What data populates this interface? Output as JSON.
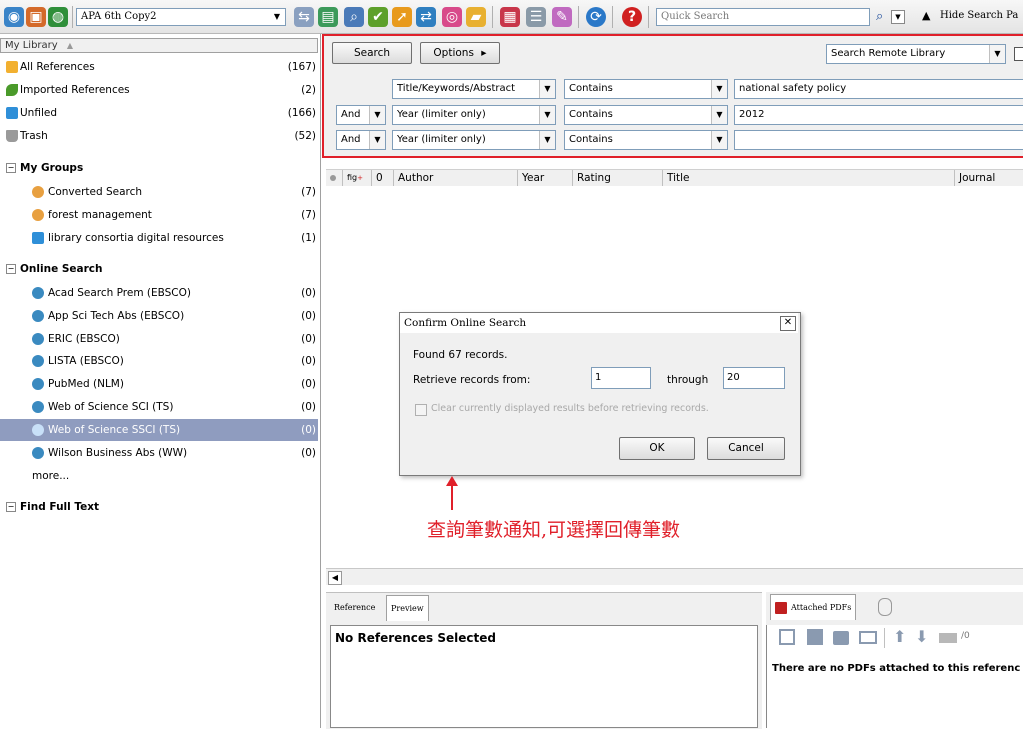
{
  "toolbar": {
    "style_name": "APA 6th Copy2",
    "quick_search_placeholder": "Quick Search",
    "hide_search_label": "Hide Search Pa"
  },
  "sidebar": {
    "header": "My Library",
    "library_items": [
      {
        "label": "All References",
        "count": "(167)",
        "icon": "all-references-icon"
      },
      {
        "label": "Imported References",
        "count": "(2)",
        "icon": "imported-references-icon"
      },
      {
        "label": "Unfiled",
        "count": "(166)",
        "icon": "unfiled-folder-icon"
      },
      {
        "label": "Trash",
        "count": "(52)",
        "icon": "trash-icon"
      }
    ],
    "my_groups_label": "My Groups",
    "groups": [
      {
        "label": "Converted Search",
        "count": "(7)"
      },
      {
        "label": "forest management",
        "count": "(7)"
      },
      {
        "label": "library consortia digital resources",
        "count": "(1)"
      }
    ],
    "online_search_label": "Online Search",
    "online_items": [
      {
        "label": "Acad Search Prem (EBSCO)",
        "count": "(0)"
      },
      {
        "label": "App Sci Tech Abs (EBSCO)",
        "count": "(0)"
      },
      {
        "label": "ERIC (EBSCO)",
        "count": "(0)"
      },
      {
        "label": "LISTA (EBSCO)",
        "count": "(0)"
      },
      {
        "label": "PubMed (NLM)",
        "count": "(0)"
      },
      {
        "label": "Web of Science SCI (TS)",
        "count": "(0)"
      },
      {
        "label": "Web of Science SSCI (TS)",
        "count": "(0)"
      },
      {
        "label": "Wilson Business Abs (WW)",
        "count": "(0)"
      }
    ],
    "more_label": "more...",
    "find_full_text_label": "Find Full Text"
  },
  "search": {
    "search_button": "Search",
    "options_button": "Options",
    "options_arrow": "▸",
    "remote_library": "Search Remote Library",
    "rows": [
      {
        "bool": "",
        "field": "Title/Keywords/Abstract",
        "op": "Contains",
        "value": "national safety policy"
      },
      {
        "bool": "And",
        "field": "Year (limiter only)",
        "op": "Contains",
        "value": "2012"
      },
      {
        "bool": "And",
        "field": "Year (limiter only)",
        "op": "Contains",
        "value": ""
      }
    ]
  },
  "columns": {
    "fig": "fig",
    "attach": "0",
    "author": "Author",
    "year": "Year",
    "rating": "Rating",
    "title": "Title",
    "journal": "Journal"
  },
  "dialog": {
    "title": "Confirm Online Search",
    "found": "Found 67 records.",
    "retrieve_label": "Retrieve records from:",
    "from_value": "1",
    "through_label": "through",
    "through_value": "20",
    "clear_label": "Clear currently displayed results before retrieving records.",
    "ok": "OK",
    "cancel": "Cancel"
  },
  "annotation": "查詢筆數通知,可選擇回傳筆數",
  "bottom": {
    "tab_reference": "Reference",
    "tab_preview": "Preview",
    "no_refs": "No References Selected",
    "tab_attached": "Attached PDFs",
    "page_count": "/0",
    "no_pdfs": "There are no PDFs attached to this referenc"
  },
  "colors": {
    "accent_red": "#e0202a",
    "selected_row": "#8f9cbf"
  }
}
